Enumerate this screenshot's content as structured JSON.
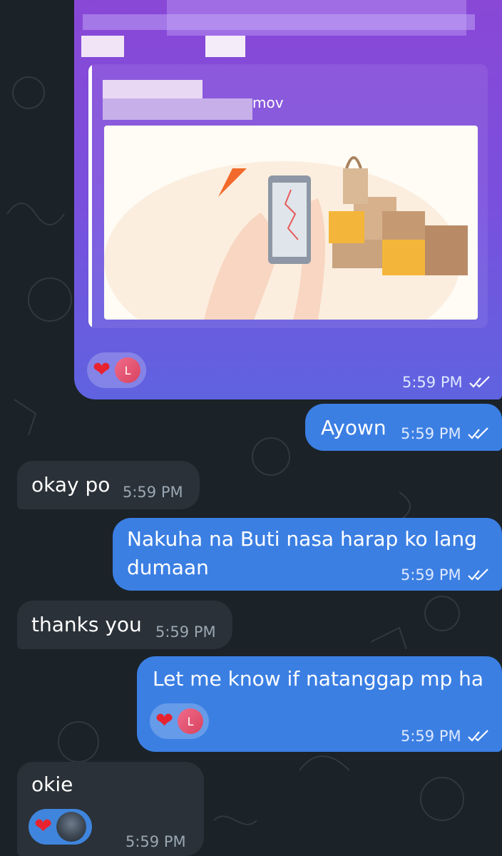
{
  "chat": {
    "media_message": {
      "preview_title_fragment": "mov",
      "reaction_heart": "❤",
      "reaction_avatar_letter": "L",
      "time": "5:59 PM"
    },
    "messages": [
      {
        "text": "Ayown",
        "time": "5:59 PM"
      },
      {
        "text": "okay po",
        "time": "5:59 PM"
      },
      {
        "text": "Nakuha na Buti nasa harap ko lang",
        "text2": "dumaan",
        "time": "5:59 PM"
      },
      {
        "text": "thanks you",
        "time": "5:59 PM"
      },
      {
        "text": "Let me know if natanggap mp ha",
        "time": "5:59 PM",
        "reaction_heart": "❤",
        "reaction_avatar_letter": "L"
      },
      {
        "text": "okie",
        "time": "5:59 PM",
        "reaction_heart": "❤"
      }
    ]
  },
  "colors": {
    "background": "#1b2228",
    "outgoing_bubble": "#3b7fe3",
    "incoming_bubble": "#2a3138",
    "media_bubble_top": "#8a47d6",
    "media_bubble_bottom": "#5f63e0"
  }
}
